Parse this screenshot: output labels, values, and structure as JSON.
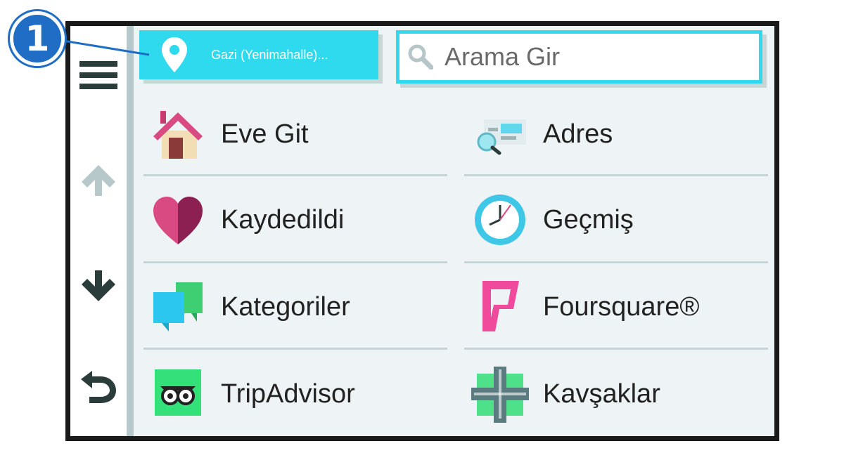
{
  "callout": {
    "number": "1"
  },
  "header": {
    "location_label": "Gazi (Yenimahalle)...",
    "search_placeholder": "Arama Gir"
  },
  "sidebar": {
    "icons": [
      "menu-icon",
      "arrow-up-icon",
      "arrow-down-icon",
      "back-icon"
    ]
  },
  "categories": [
    {
      "label": "Eve Git",
      "icon": "home-icon"
    },
    {
      "label": "Adres",
      "icon": "address-icon"
    },
    {
      "label": "Kaydedildi",
      "icon": "heart-icon"
    },
    {
      "label": "Geçmiş",
      "icon": "clock-icon"
    },
    {
      "label": "Kategoriler",
      "icon": "categories-icon"
    },
    {
      "label": "Foursquare®",
      "icon": "foursquare-icon"
    },
    {
      "label": "TripAdvisor",
      "icon": "tripadvisor-icon"
    },
    {
      "label": "Kavşaklar",
      "icon": "intersection-icon"
    }
  ],
  "colors": {
    "accent": "#2fd9ee",
    "callout": "#1f6dc4",
    "sidebar_icon": "#2b3d3a",
    "sidebar_icon_disabled": "#b7c8cb"
  }
}
